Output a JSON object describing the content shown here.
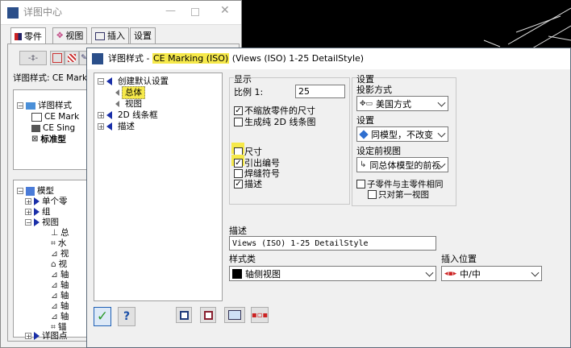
{
  "back_window": {
    "title": "详图中心",
    "tabs": [
      {
        "label": "零件",
        "icon": "parts-icon"
      },
      {
        "label": "视图",
        "icon": "view-icon"
      },
      {
        "label": "插入",
        "icon": "insert-icon"
      },
      {
        "label": "设置",
        "icon": ""
      }
    ],
    "style_label": "详图样式: CE Marki",
    "tree_top": [
      {
        "label": "详图样式",
        "icon": "folder-icon"
      },
      {
        "label": "CE Mark",
        "icon": "detail-style-icon"
      },
      {
        "label": "CE Sing",
        "icon": "detail-style-icon"
      },
      {
        "label": "标准型",
        "icon": "detail-style-icon"
      }
    ],
    "tree_model": [
      {
        "label": "模型",
        "icon": "model-icon"
      },
      {
        "label": "单个零",
        "icon": "arrow-icon"
      },
      {
        "label": "组",
        "icon": "arrow-icon"
      },
      {
        "label": "视图",
        "icon": "arrow-icon"
      },
      {
        "label": "总",
        "icon": "view-item-icon"
      },
      {
        "label": "水",
        "icon": "view-item-icon"
      },
      {
        "label": "视",
        "icon": "view-item-icon"
      },
      {
        "label": "视",
        "icon": "view-item-icon"
      },
      {
        "label": "轴",
        "icon": "view-item-icon"
      },
      {
        "label": "轴",
        "icon": "view-item-icon"
      },
      {
        "label": "轴",
        "icon": "view-item-icon"
      },
      {
        "label": "轴",
        "icon": "view-item-icon"
      },
      {
        "label": "轴",
        "icon": "view-item-icon"
      },
      {
        "label": "锚",
        "icon": "view-item-icon"
      },
      {
        "label": "详图点",
        "icon": "arrow-icon"
      }
    ]
  },
  "dialog": {
    "title_prefix": "详图样式 - ",
    "title_highlight": "CE Marking (ISO)",
    "title_suffix": " (Views (ISO) 1-25 DetailStyle)",
    "tree": [
      {
        "label": "创建默认设置"
      },
      {
        "label": "总体"
      },
      {
        "label": "视图"
      },
      {
        "label": "2D 线条框"
      },
      {
        "label": "描述"
      }
    ],
    "display": {
      "heading": "显示",
      "scale_label": "比例 1:",
      "scale_value": "25",
      "chk_no_shrink": "不缩放零件的尺寸",
      "chk_no_shrink_checked": true,
      "chk_2d": "生成纯 2D 线条图",
      "chk_2d_checked": false,
      "chk_dim": "尺寸",
      "chk_dim_checked": false,
      "chk_lead": "引出编号",
      "chk_lead_checked": true,
      "chk_weld": "焊缝符号",
      "chk_weld_checked": false,
      "chk_desc": "描述",
      "chk_desc_checked": true
    },
    "settings": {
      "heading": "设置",
      "projection_label": "投影方式",
      "projection_value": "美国方式",
      "setting_label": "设置",
      "setting_value": "同模型，不改变",
      "before_label": "设定前视图",
      "before_value": "同总体模型的前视",
      "chk_sub": "子零件与主零件相同",
      "chk_sub_checked": false,
      "chk_first": "只对第一视图",
      "chk_first_checked": false
    },
    "description": {
      "label": "描述",
      "value": "Views (ISO) 1-25 DetailStyle"
    },
    "style_class": {
      "label": "样式类",
      "value": "轴侧视图"
    },
    "insert_pos": {
      "label": "插入位置",
      "value": "中/中"
    },
    "help_label": "?"
  },
  "colors": {
    "highlight": "#f6e94a",
    "tree_arrow": "#1a2fa8",
    "ok_green": "#2a9a2a"
  }
}
